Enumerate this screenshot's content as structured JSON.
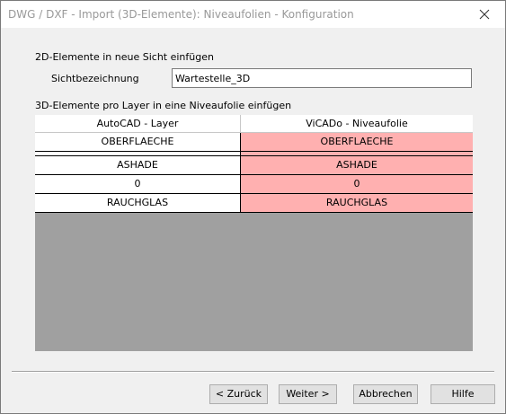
{
  "window": {
    "title": "DWG / DXF - Import (3D-Elemente): Niveaufolien - Konfiguration"
  },
  "section_2d": {
    "heading": "2D-Elemente in neue Sicht einfügen",
    "view_name_label": "Sichtbezeichnung",
    "view_name_value": "Wartestelle_3D"
  },
  "section_3d": {
    "heading": "3D-Elemente pro Layer in eine Niveaufolie einfügen",
    "columns": [
      "AutoCAD - Layer",
      "ViCADo - Niveaufolie"
    ],
    "rows": [
      {
        "layer": "OBERFLAECHE",
        "folie": "OBERFLAECHE"
      },
      {
        "layer": "",
        "folie": ""
      },
      {
        "layer": "ASHADE",
        "folie": "ASHADE"
      },
      {
        "layer": "0",
        "folie": "0"
      },
      {
        "layer": "RAUCHGLAS",
        "folie": "RAUCHGLAS"
      }
    ]
  },
  "buttons": {
    "back": "< Zurück",
    "next": "Weiter >",
    "cancel": "Abbrechen",
    "help": "Hilfe"
  },
  "colors": {
    "mapped_cell": "#ffb0b0",
    "empty_grid": "#a0a0a0"
  },
  "icons": {
    "close": "close-icon"
  }
}
